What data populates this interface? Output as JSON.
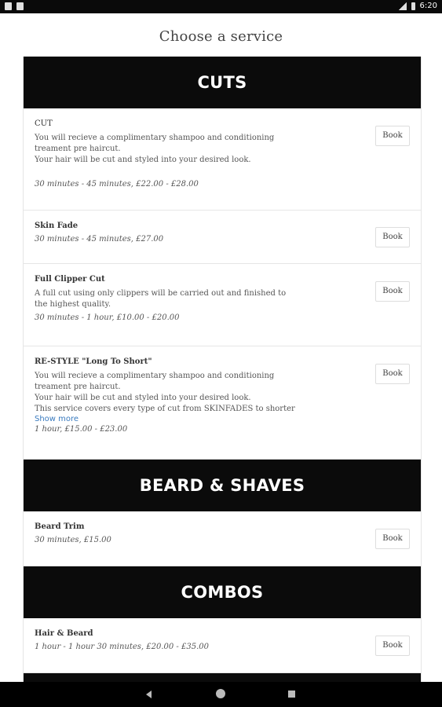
{
  "status_bar": {
    "time": "6:20"
  },
  "page": {
    "title": "Choose a service"
  },
  "book_label": "Book",
  "categories": [
    {
      "title": "CUTS",
      "items": [
        {
          "name": "CUT",
          "description": "You will recieve a complimentary shampoo and conditioning treament pre haircut.\nYour hair will be cut and styled into your desired look.",
          "meta": "30 minutes - 45 minutes, £22.00 - £28.00"
        },
        {
          "name": "Skin Fade",
          "description": "",
          "meta": "30 minutes - 45 minutes, £27.00"
        },
        {
          "name": "Full Clipper Cut",
          "description": "A full cut using only clippers will be carried out and finished to the highest quality.",
          "meta": "30 minutes - 1 hour, £10.00 - £20.00"
        },
        {
          "name": "RE-STYLE \"Long To Short\"",
          "description": "You will recieve a complimentary shampoo and conditioning treament pre haircut.\nYour hair will be cut and styled into your desired look.\nThis service covers every type of cut from SKINFADES to shorter styles",
          "show_more": "Show more",
          "meta": "1 hour, £15.00 - £23.00"
        }
      ]
    },
    {
      "title": "BEARD & SHAVES",
      "items": [
        {
          "name": "Beard Trim",
          "description": "",
          "meta": "30 minutes, £15.00"
        }
      ]
    },
    {
      "title": "COMBOS",
      "items": [
        {
          "name": "Hair & Beard",
          "description": "",
          "meta": "1 hour - 1 hour 30 minutes, £20.00 - £35.00"
        }
      ]
    }
  ]
}
